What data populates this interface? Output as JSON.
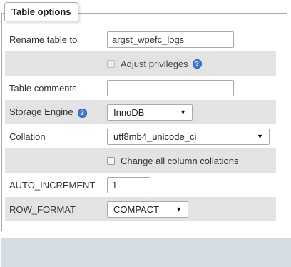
{
  "legend": "Table options",
  "rows": {
    "rename": {
      "label": "Rename table to",
      "value": "argst_wpefc_logs"
    },
    "privileges": {
      "label": "Adjust privileges",
      "help_icon": "help-icon"
    },
    "comments": {
      "label": "Table comments",
      "value": ""
    },
    "engine": {
      "label": "Storage Engine",
      "value": "InnoDB",
      "help_icon": "help-icon"
    },
    "collation": {
      "label": "Collation",
      "value": "utf8mb4_unicode_ci"
    },
    "change_collations": {
      "label": "Change all column collations"
    },
    "auto_increment": {
      "label": "AUTO_INCREMENT",
      "value": "1"
    },
    "row_format": {
      "label": "ROW_FORMAT",
      "value": "COMPACT"
    }
  },
  "colors": {
    "alt_row": "#e3e3e3",
    "border": "#aaaaaa",
    "help_icon": "#3b7dd8",
    "footer": "#d4dce4"
  }
}
